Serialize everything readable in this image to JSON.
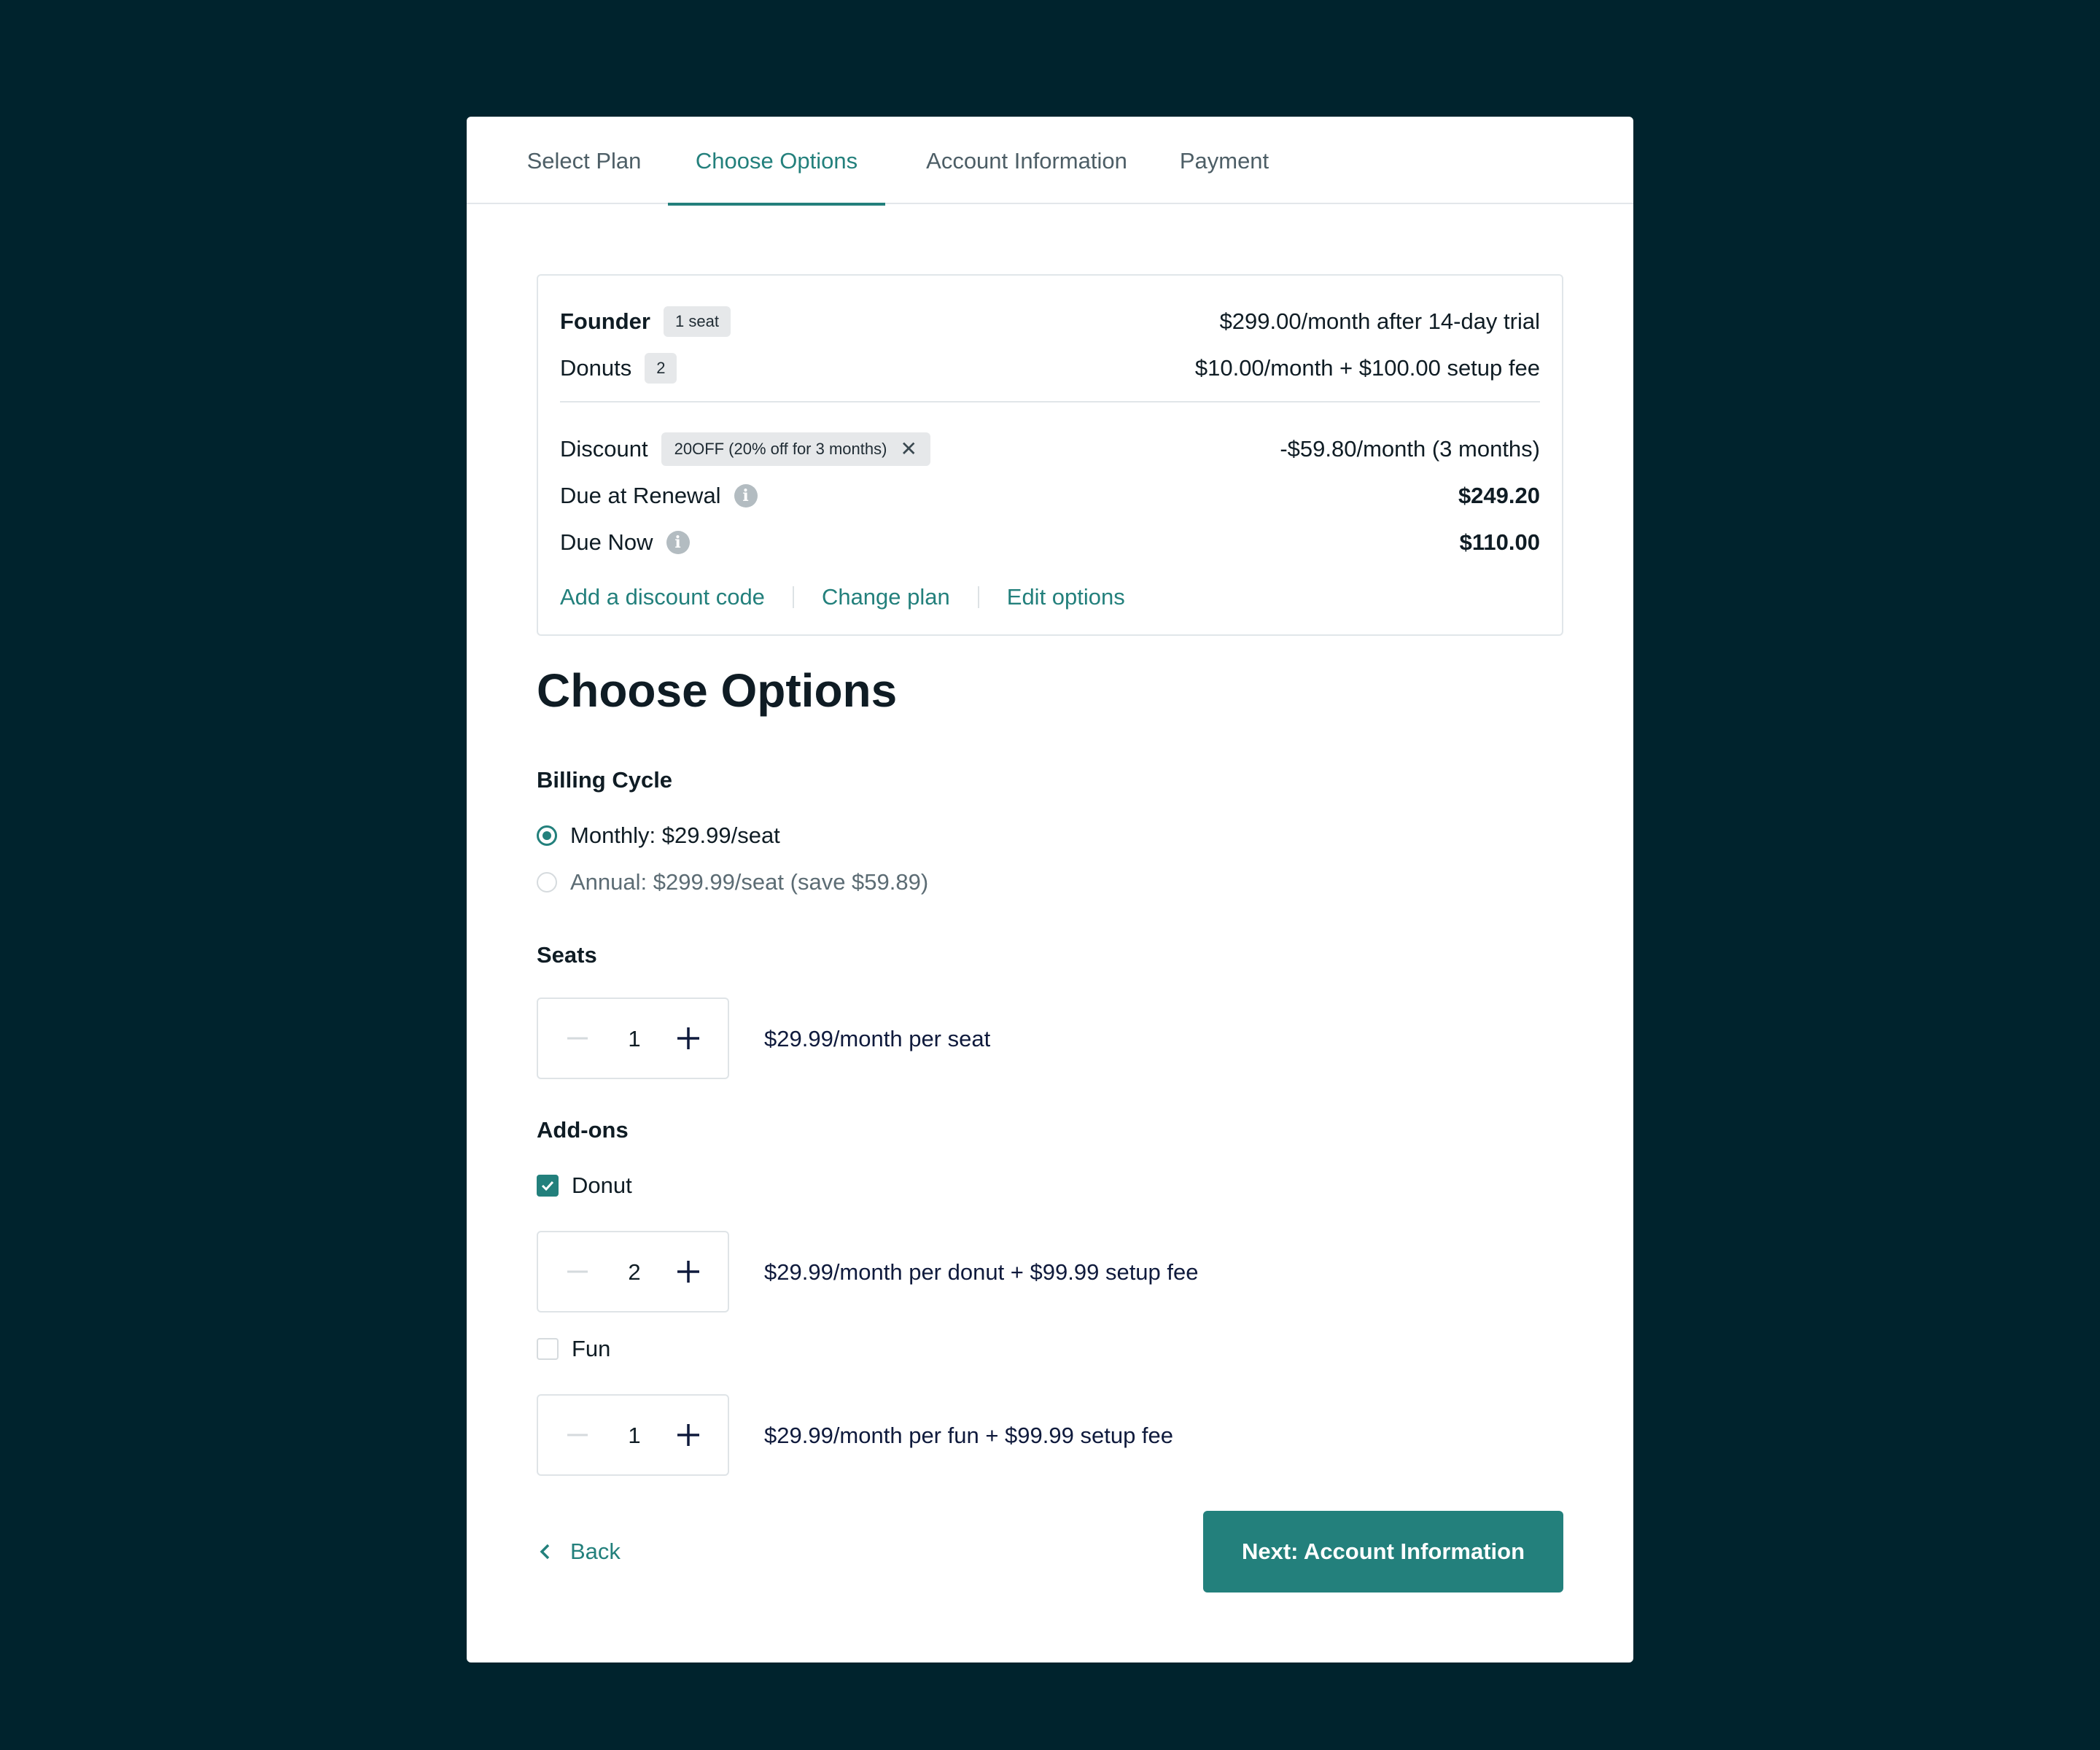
{
  "tabs": [
    {
      "label": "Select Plan"
    },
    {
      "label": "Choose Options"
    },
    {
      "label": "Account Information"
    },
    {
      "label": "Payment"
    }
  ],
  "active_tab": "Choose Options",
  "summary": {
    "plan": {
      "name": "Founder",
      "badge": "1 seat",
      "price": "$299.00/month after 14-day trial"
    },
    "addon": {
      "name": "Donuts",
      "badge": "2",
      "price": "$10.00/month + $100.00 setup fee"
    },
    "discount": {
      "label": "Discount",
      "code": "20OFF (20% off for 3 months)",
      "amount": "-$59.80/month (3 months)"
    },
    "due_renewal": {
      "label": "Due at Renewal",
      "amount": "$249.20"
    },
    "due_now": {
      "label": "Due Now",
      "amount": "$110.00"
    },
    "links": {
      "add_discount": "Add a discount code",
      "change_plan": "Change plan",
      "edit_options": "Edit options"
    }
  },
  "heading": "Choose Options",
  "billing": {
    "title": "Billing Cycle",
    "options": [
      {
        "label": "Monthly: $29.99/seat",
        "selected": true
      },
      {
        "label": "Annual: $299.99/seat (save $59.89)",
        "selected": false
      }
    ]
  },
  "seats": {
    "title": "Seats",
    "value": "1",
    "desc": "$29.99/month per seat"
  },
  "addons": {
    "title": "Add-ons",
    "items": [
      {
        "label": "Donut",
        "checked": true,
        "value": "2",
        "desc": "$29.99/month per donut + $99.99 setup fee"
      },
      {
        "label": "Fun",
        "checked": false,
        "value": "1",
        "desc": "$29.99/month per fun + $99.99 setup fee"
      }
    ]
  },
  "footer": {
    "back": "Back",
    "next": "Next: Account Information"
  },
  "colors": {
    "accent": "#23807c",
    "background": "#00232d"
  }
}
